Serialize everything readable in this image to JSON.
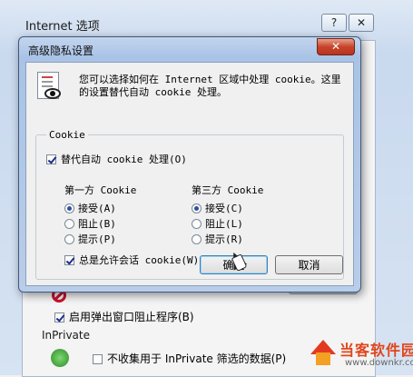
{
  "background_window": {
    "title": "Internet 选项",
    "help_label": "?",
    "close_label": "✕",
    "popup_blocker_label": "启用弹出窗口阻止程序(B)",
    "popup_blocker_checked": true,
    "inprivate_section": "InPrivate",
    "inprivate_option": "不收集用于 InPrivate 筛选的数据(P)",
    "inprivate_checked": false
  },
  "dialog": {
    "title": "高级隐私设置",
    "close_label": "✕",
    "description": "您可以选择如何在 Internet 区域中处理 cookie。这里的设置替代自动 cookie 处理。",
    "group_label": "Cookie",
    "override_label": "替代自动 cookie 处理(O)",
    "override_checked": true,
    "first_party": {
      "header": "第一方 Cookie",
      "options": [
        {
          "label": "接受(A)",
          "selected": true
        },
        {
          "label": "阻止(B)",
          "selected": false
        },
        {
          "label": "提示(P)",
          "selected": false
        }
      ]
    },
    "third_party": {
      "header": "第三方 Cookie",
      "options": [
        {
          "label": "接受(C)",
          "selected": true
        },
        {
          "label": "阻止(L)",
          "selected": false
        },
        {
          "label": "提示(R)",
          "selected": false
        }
      ]
    },
    "session_label": "总是允许会话 cookie(W)",
    "session_checked": true,
    "ok_label": "确定",
    "cancel_label": "取消"
  },
  "watermark": {
    "brand": "当客软件园",
    "url": "www.downkr.com"
  }
}
